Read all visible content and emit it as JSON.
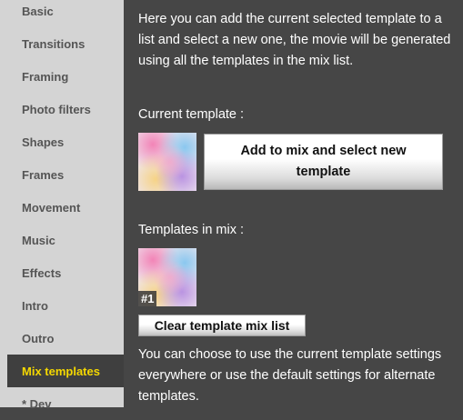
{
  "sidebar": {
    "items": [
      {
        "label": "Basic"
      },
      {
        "label": "Transitions"
      },
      {
        "label": "Framing"
      },
      {
        "label": "Photo filters"
      },
      {
        "label": "Shapes"
      },
      {
        "label": "Frames"
      },
      {
        "label": "Movement"
      },
      {
        "label": "Music"
      },
      {
        "label": "Effects"
      },
      {
        "label": "Intro"
      },
      {
        "label": "Outro"
      },
      {
        "label": "Mix templates",
        "active": true
      },
      {
        "label": "* Dev"
      }
    ],
    "active_color": "#f5d800"
  },
  "main": {
    "intro_text": "Here you can add the current selected template to a list and select a new one, the movie will be generated using all the templates in the mix list.",
    "current_template_label": "Current template :",
    "add_button_label": "Add to mix and select new template",
    "templates_in_mix_label": "Templates in mix :",
    "mix_items": [
      {
        "badge": "#1"
      }
    ],
    "clear_button_label": "Clear template mix list",
    "footer_text": "You can choose to use the current template settings everywhere or use the default settings for alternate templates."
  }
}
